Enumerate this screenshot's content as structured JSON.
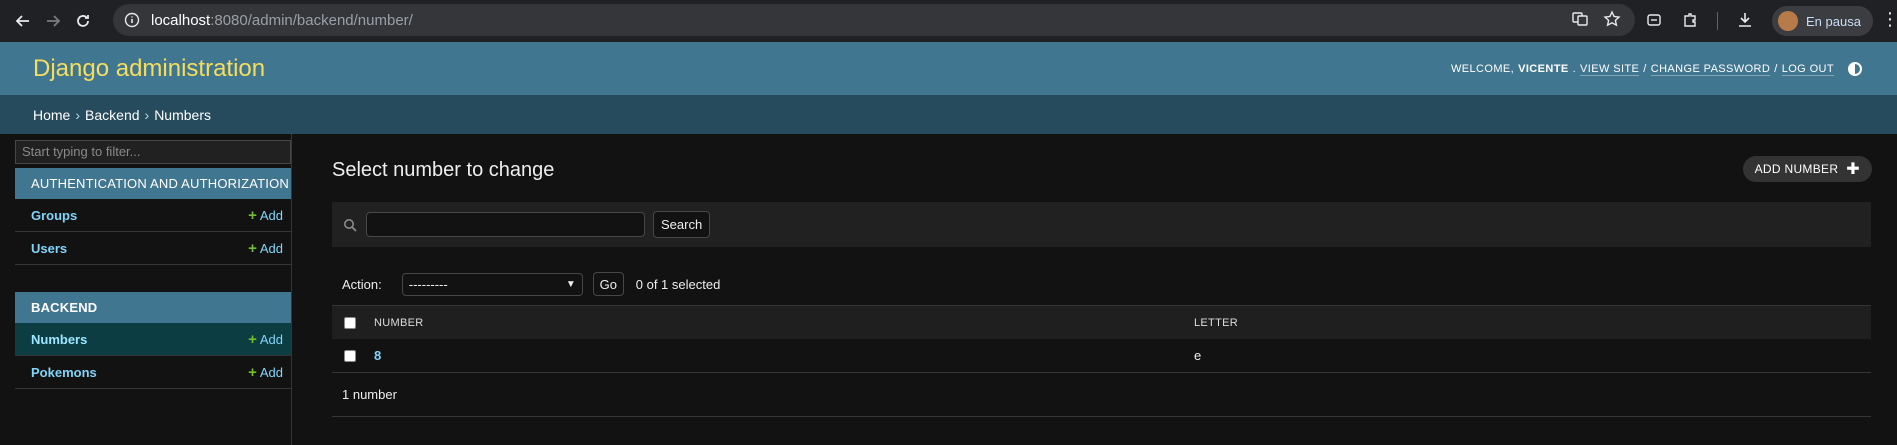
{
  "browser": {
    "url_host": "localhost",
    "url_path": ":8080/admin/backend/number/",
    "profile_label": "En pausa"
  },
  "header": {
    "branding": "Django administration",
    "welcome": "WELCOME,",
    "username": "VICENTE",
    "view_site": "VIEW SITE",
    "change_password": "CHANGE PASSWORD",
    "log_out": "LOG OUT",
    "sep": "/"
  },
  "breadcrumbs": {
    "home": "Home",
    "app": "Backend",
    "current": "Numbers",
    "sep": "›"
  },
  "sidebar": {
    "filter_placeholder": "Start typing to filter...",
    "add_label": "Add",
    "modules": [
      {
        "caption": "AUTHENTICATION AND AUTHORIZATION",
        "items": [
          {
            "label": "Groups"
          },
          {
            "label": "Users"
          }
        ]
      },
      {
        "caption": "BACKEND",
        "items": [
          {
            "label": "Numbers",
            "current": true
          },
          {
            "label": "Pokemons"
          }
        ]
      }
    ]
  },
  "content": {
    "title": "Select number to change",
    "add_button": "ADD NUMBER",
    "search_button": "Search",
    "action_label": "Action:",
    "action_selected": "---------",
    "go_button": "Go",
    "selected_count": "0 of 1 selected",
    "columns": {
      "number": "NUMBER",
      "letter": "LETTER"
    },
    "rows": [
      {
        "number": "8",
        "letter": "e"
      }
    ],
    "paginator": "1 number"
  }
}
